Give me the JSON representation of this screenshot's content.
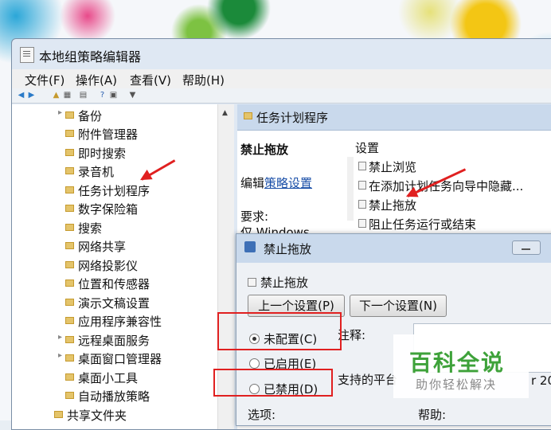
{
  "window": {
    "title": "本地组策略编辑器"
  },
  "menu": [
    "文件(F)",
    "操作(A)",
    "查看(V)",
    "帮助(H)"
  ],
  "tree": [
    "备份",
    "附件管理器",
    "即时搜索",
    "录音机",
    "任务计划程序",
    "数字保险箱",
    "搜索",
    "网络共享",
    "网络投影仪",
    "位置和传感器",
    "演示文稿设置",
    "应用程序兼容性",
    "远程桌面服务",
    "桌面窗口管理器",
    "桌面小工具",
    "自动播放策略",
    "共享文件夹"
  ],
  "right_pane": {
    "header": "任务计划程序",
    "selected_title": "禁止拖放",
    "edit_prefix": "编辑",
    "edit_link": "策略设置",
    "requirement_label": "要求:",
    "requirement_value": "仅 Windows",
    "list_header": "设置",
    "items": [
      "禁止浏览",
      "在添加计划任务向导中隐藏...",
      "禁止拖放",
      "阻止任务运行或结束"
    ]
  },
  "dialog": {
    "title": "禁止拖放",
    "subtitle": "禁止拖放",
    "prev_button": "上一个设置(P)",
    "next_button": "下一个设置(N)",
    "comment_label": "注释:",
    "radio_not_configured": "未配置(C)",
    "radio_enabled": "已启用(E)",
    "radio_disabled": "已禁用(D)",
    "selected_option": "未配置(C)",
    "supported_label": "支持的平台",
    "supported_tail": "r 20",
    "options_label": "选项:",
    "help_label": "帮助:"
  },
  "watermark": {
    "main": "百科全说",
    "sub": "助你轻松解决"
  },
  "colors": {
    "annotation": "#e02020",
    "link": "#1a4fa8",
    "watermark_green": "#3ea23a"
  }
}
